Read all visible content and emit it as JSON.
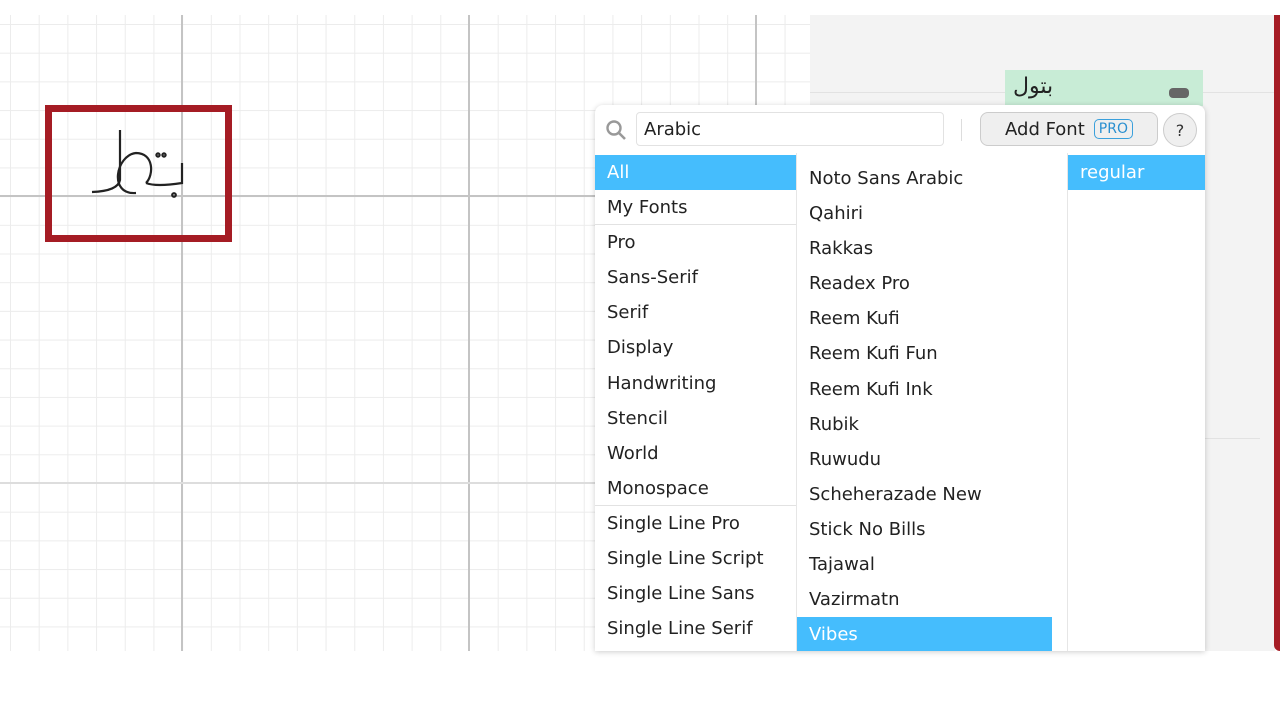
{
  "canvas": {
    "glyph_text": "بتول",
    "selection_color": "#a51c24"
  },
  "panel": {
    "chip_text": "بتول"
  },
  "font_picker": {
    "search_value": "Arabic",
    "add_font_label": "Add Font",
    "pro_badge": "PRO",
    "help_label": "?",
    "categories": [
      "All",
      "My Fonts",
      "Pro",
      "Sans-Serif",
      "Serif",
      "Display",
      "Handwriting",
      "Stencil",
      "World",
      "Monospace",
      "Single Line Pro",
      "Single Line Script",
      "Single Line Sans",
      "Single Line Serif"
    ],
    "selected_category": "All",
    "fonts": [
      "Noto Sans Arabic",
      "Qahiri",
      "Rakkas",
      "Readex Pro",
      "Reem Kufi",
      "Reem Kufi Fun",
      "Reem Kufi Ink",
      "Rubik",
      "Ruwudu",
      "Scheherazade New",
      "Stick No Bills",
      "Tajawal",
      "Vazirmatn",
      "Vibes"
    ],
    "selected_font": "Vibes",
    "styles": [
      "regular"
    ],
    "selected_style": "regular",
    "accent_color": "#45bdfd"
  }
}
